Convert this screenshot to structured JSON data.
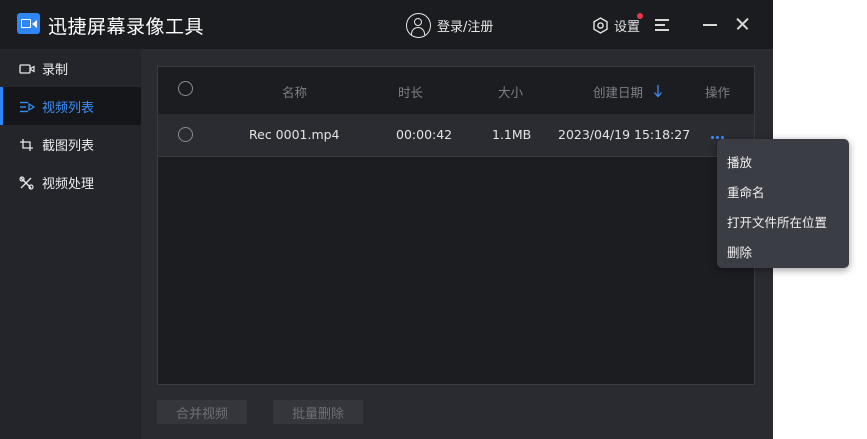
{
  "app": {
    "title": "迅捷屏幕录像工具",
    "accent_color": "#2f86f6"
  },
  "header": {
    "login_label": "登录/注册",
    "settings_label": "设置",
    "icons": [
      "user-icon",
      "gear-icon",
      "menu-icon",
      "minimize-icon",
      "close-icon"
    ]
  },
  "sidebar": {
    "items": [
      {
        "label": "录制",
        "icon": "camera-icon",
        "active": false
      },
      {
        "label": "视频列表",
        "icon": "list-icon",
        "active": true
      },
      {
        "label": "截图列表",
        "icon": "screenshot-icon",
        "active": false
      },
      {
        "label": "视频处理",
        "icon": "tools-icon",
        "active": false
      }
    ]
  },
  "table": {
    "columns": {
      "name": "名称",
      "duration": "时长",
      "size": "大小",
      "created": "创建日期",
      "actions": "操作"
    },
    "sort": {
      "column": "created",
      "direction": "down"
    },
    "rows": [
      {
        "name": "Rec 0001.mp4",
        "duration": "00:00:42",
        "size": "1.1MB",
        "created": "2023/04/19 15:18:27"
      }
    ]
  },
  "footer": {
    "merge_label": "合并视频",
    "batch_delete_label": "批量删除"
  },
  "context_menu": {
    "items": [
      "播放",
      "重命名",
      "打开文件所在位置",
      "删除"
    ]
  }
}
